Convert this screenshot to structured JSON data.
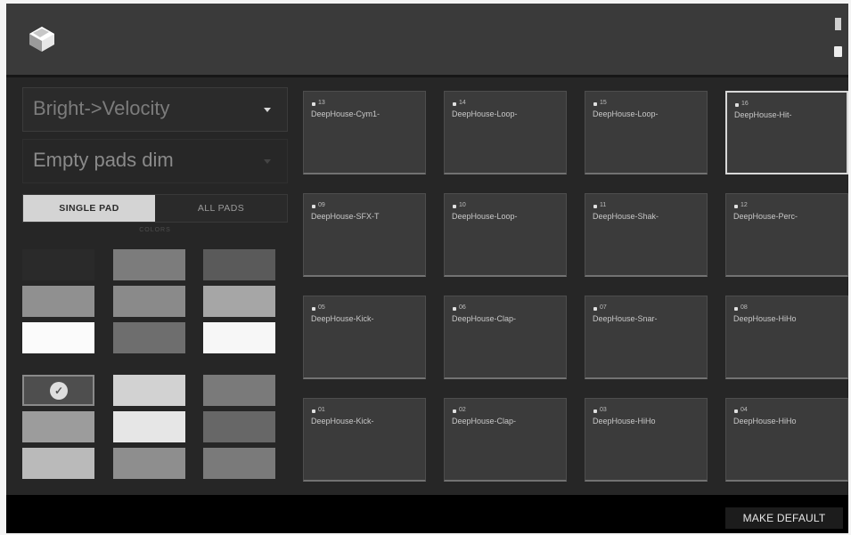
{
  "header": {
    "logo_icon": "app-logo-icon",
    "right_icons": [
      "status-icon",
      "battery-icon"
    ]
  },
  "left_panel": {
    "dropdown1": {
      "label": "Bright->Velocity",
      "icon": "chevron-down-icon"
    },
    "dropdown2": {
      "label": "Empty pads dim",
      "icon": "chevron-down-icon"
    },
    "segmented": {
      "single": "SINGLE PAD",
      "all": "ALL PADS",
      "selected": "SINGLE PAD"
    },
    "colors_label": "COLORS",
    "swatches": [
      {
        "color": "#2a2a2a",
        "selected": false
      },
      {
        "color": "#7c7c7c",
        "selected": false
      },
      {
        "color": "#5a5a5a",
        "selected": false
      },
      {
        "color": "#909090",
        "selected": false
      },
      {
        "color": "#8a8a8a",
        "selected": false
      },
      {
        "color": "#a6a6a6",
        "selected": false
      },
      {
        "color": "#fbfbfb",
        "selected": false
      },
      {
        "color": "#6e6e6e",
        "selected": false
      },
      {
        "color": "#f7f7f7",
        "selected": false
      },
      {
        "color": "#4e4e4e",
        "selected": true
      },
      {
        "color": "#d2d2d2",
        "selected": false
      },
      {
        "color": "#7a7a7a",
        "selected": false
      },
      {
        "color": "#9c9c9c",
        "selected": false
      },
      {
        "color": "#e6e6e6",
        "selected": false
      },
      {
        "color": "#676767",
        "selected": false
      },
      {
        "color": "#bababa",
        "selected": false
      },
      {
        "color": "#8e8e8e",
        "selected": false
      },
      {
        "color": "#7a7a7a",
        "selected": false
      }
    ],
    "check_icon": "checkmark-icon"
  },
  "pads": [
    {
      "num": "13",
      "name": "DeepHouse-Cym1-",
      "highlighted": false
    },
    {
      "num": "14",
      "name": "DeepHouse-Loop-",
      "highlighted": false
    },
    {
      "num": "15",
      "name": "DeepHouse-Loop-",
      "highlighted": false
    },
    {
      "num": "16",
      "name": "DeepHouse-Hit-",
      "highlighted": true
    },
    {
      "num": "09",
      "name": "DeepHouse-SFX-T",
      "highlighted": false
    },
    {
      "num": "10",
      "name": "DeepHouse-Loop-",
      "highlighted": false
    },
    {
      "num": "11",
      "name": "DeepHouse-Shak-",
      "highlighted": false
    },
    {
      "num": "12",
      "name": "DeepHouse-Perc-",
      "highlighted": false
    },
    {
      "num": "05",
      "name": "DeepHouse-Kick-",
      "highlighted": false
    },
    {
      "num": "06",
      "name": "DeepHouse-Clap-",
      "highlighted": false
    },
    {
      "num": "07",
      "name": "DeepHouse-Snar-",
      "highlighted": false
    },
    {
      "num": "08",
      "name": "DeepHouse-HiHo",
      "highlighted": false
    },
    {
      "num": "01",
      "name": "DeepHouse-Kick-",
      "highlighted": false
    },
    {
      "num": "02",
      "name": "DeepHouse-Clap-",
      "highlighted": false
    },
    {
      "num": "03",
      "name": "DeepHouse-HiHo",
      "highlighted": false
    },
    {
      "num": "04",
      "name": "DeepHouse-HiHo",
      "highlighted": false
    }
  ],
  "footer": {
    "make_default": "MAKE DEFAULT"
  }
}
